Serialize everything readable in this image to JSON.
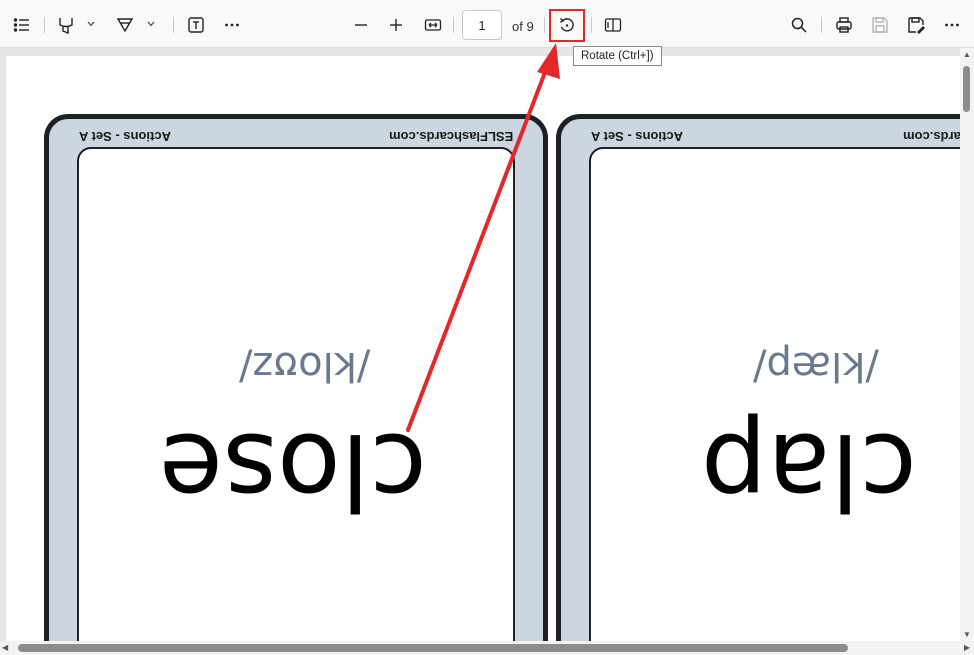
{
  "toolbar": {
    "contents_icon": "list-icon",
    "highlight_icon": "highlighter-icon",
    "draw_icon": "draw-icon",
    "text_icon": "text-box-icon",
    "more_icon": "more-icon",
    "zoom_out_icon": "minus-icon",
    "zoom_in_icon": "plus-icon",
    "fit_icon": "fit-width-icon",
    "page_value": "1",
    "page_total_label": "of 9",
    "rotate_icon": "rotate-icon",
    "two_page_icon": "two-page-icon",
    "search_icon": "search-icon",
    "print_icon": "print-icon",
    "save_icon": "save-icon",
    "save_as_icon": "save-as-icon",
    "overflow_icon": "more-icon"
  },
  "tooltip": {
    "text": "Rotate (Ctrl+])"
  },
  "cards": [
    {
      "brand": "ESLFlashcards.com",
      "set": "Actions - Set A",
      "ipa": "/kloʊz/",
      "word": "close"
    },
    {
      "brand": "ESLFlashcards.com",
      "set": "Actions - Set A",
      "ipa": "/klæp/",
      "word": "clap"
    }
  ],
  "colors": {
    "annotation_red": "#e3282a",
    "card_border": "#1e2024",
    "card_fill": "#ccd6e0",
    "ipa_color": "#6a7890"
  }
}
